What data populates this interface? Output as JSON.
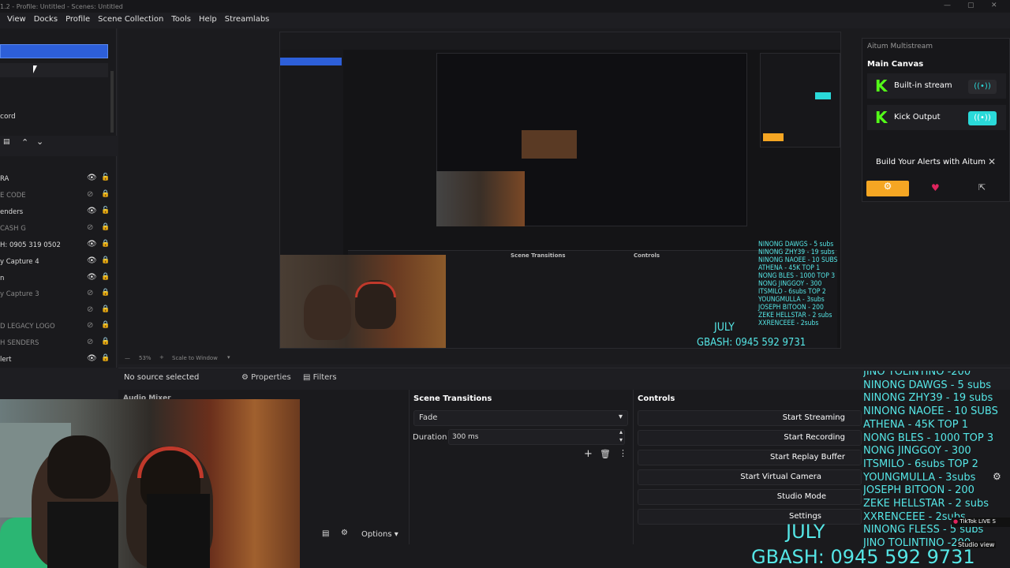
{
  "titlebar": {
    "title": "1.2 - Profile: Untitled - Scenes: Untitled"
  },
  "menu": [
    "View",
    "Docks",
    "Profile",
    "Scene Collection",
    "Tools",
    "Help",
    "Streamlabs"
  ],
  "scenes": {
    "third_label": "cord"
  },
  "sources": [
    {
      "name": "RA",
      "visible": true,
      "locked": false
    },
    {
      "name": "E CODE",
      "visible": false,
      "locked": true
    },
    {
      "name": "enders",
      "visible": true,
      "locked": false
    },
    {
      "name": "CASH G",
      "visible": false,
      "locked": true
    },
    {
      "name": "H: 0905 319 0502",
      "visible": true,
      "locked": true
    },
    {
      "name": "y Capture 4",
      "visible": true,
      "locked": true
    },
    {
      "name": "n",
      "visible": true,
      "locked": true
    },
    {
      "name": "y Capture 3",
      "visible": false,
      "locked": true
    },
    {
      "name": "",
      "visible": false,
      "locked": true
    },
    {
      "name": "D LEGACY LOGO",
      "visible": false,
      "locked": true
    },
    {
      "name": "H SENDERS",
      "visible": false,
      "locked": true
    },
    {
      "name": "lert",
      "visible": true,
      "locked": true
    }
  ],
  "preview_footer": {
    "zoom": "53%",
    "scale": "Scale to Window"
  },
  "context": {
    "no_source": "No source selected",
    "properties": "Properties",
    "filters": "Filters"
  },
  "audio_mixer": {
    "title": "Audio Mixer"
  },
  "scene_transitions": {
    "title": "Scene Transitions",
    "transition": "Fade",
    "duration_label": "Duration",
    "duration_value": "300 ms"
  },
  "controls": {
    "title": "Controls",
    "buttons": [
      "Start Streaming",
      "Start Recording",
      "Start Replay Buffer",
      "Start Virtual Camera",
      "Studio Mode",
      "Settings"
    ]
  },
  "options": {
    "label": "Options"
  },
  "aitum": {
    "title": "Aitum Multistream",
    "canvas": "Main Canvas",
    "streams": [
      "Built-in stream",
      "Kick Output"
    ],
    "alerts_banner": "Build Your Alerts with Aitum",
    "accent": "#f5a623"
  },
  "overlay": {
    "subs": [
      "JINO TOLINTINO -200",
      "NINONG DAWGS - 5 subs",
      "NINONG ZHY39 - 19 subs",
      "NINONG NAOEE - 10 SUBS",
      "ATHENA - 45K  TOP 1",
      "NONG BLES - 1000  TOP 3",
      "NONG JINGGOY - 300",
      "ITSMILO - 6subs  TOP 2",
      "YOUNGMULLA - 3subs",
      "JOSEPH BITOON - 200",
      "ZEKE HELLSTAR - 2 subs",
      "XXRENCEEE - 2subs",
      "NINONG FLESS - 5 subs",
      "JINO TOLINTINO -200"
    ],
    "month": "JULY",
    "gcash": "GBASH: 0945 592 9731",
    "tiktok": "TikTok LIVE S",
    "studio_view": "Studio view"
  }
}
